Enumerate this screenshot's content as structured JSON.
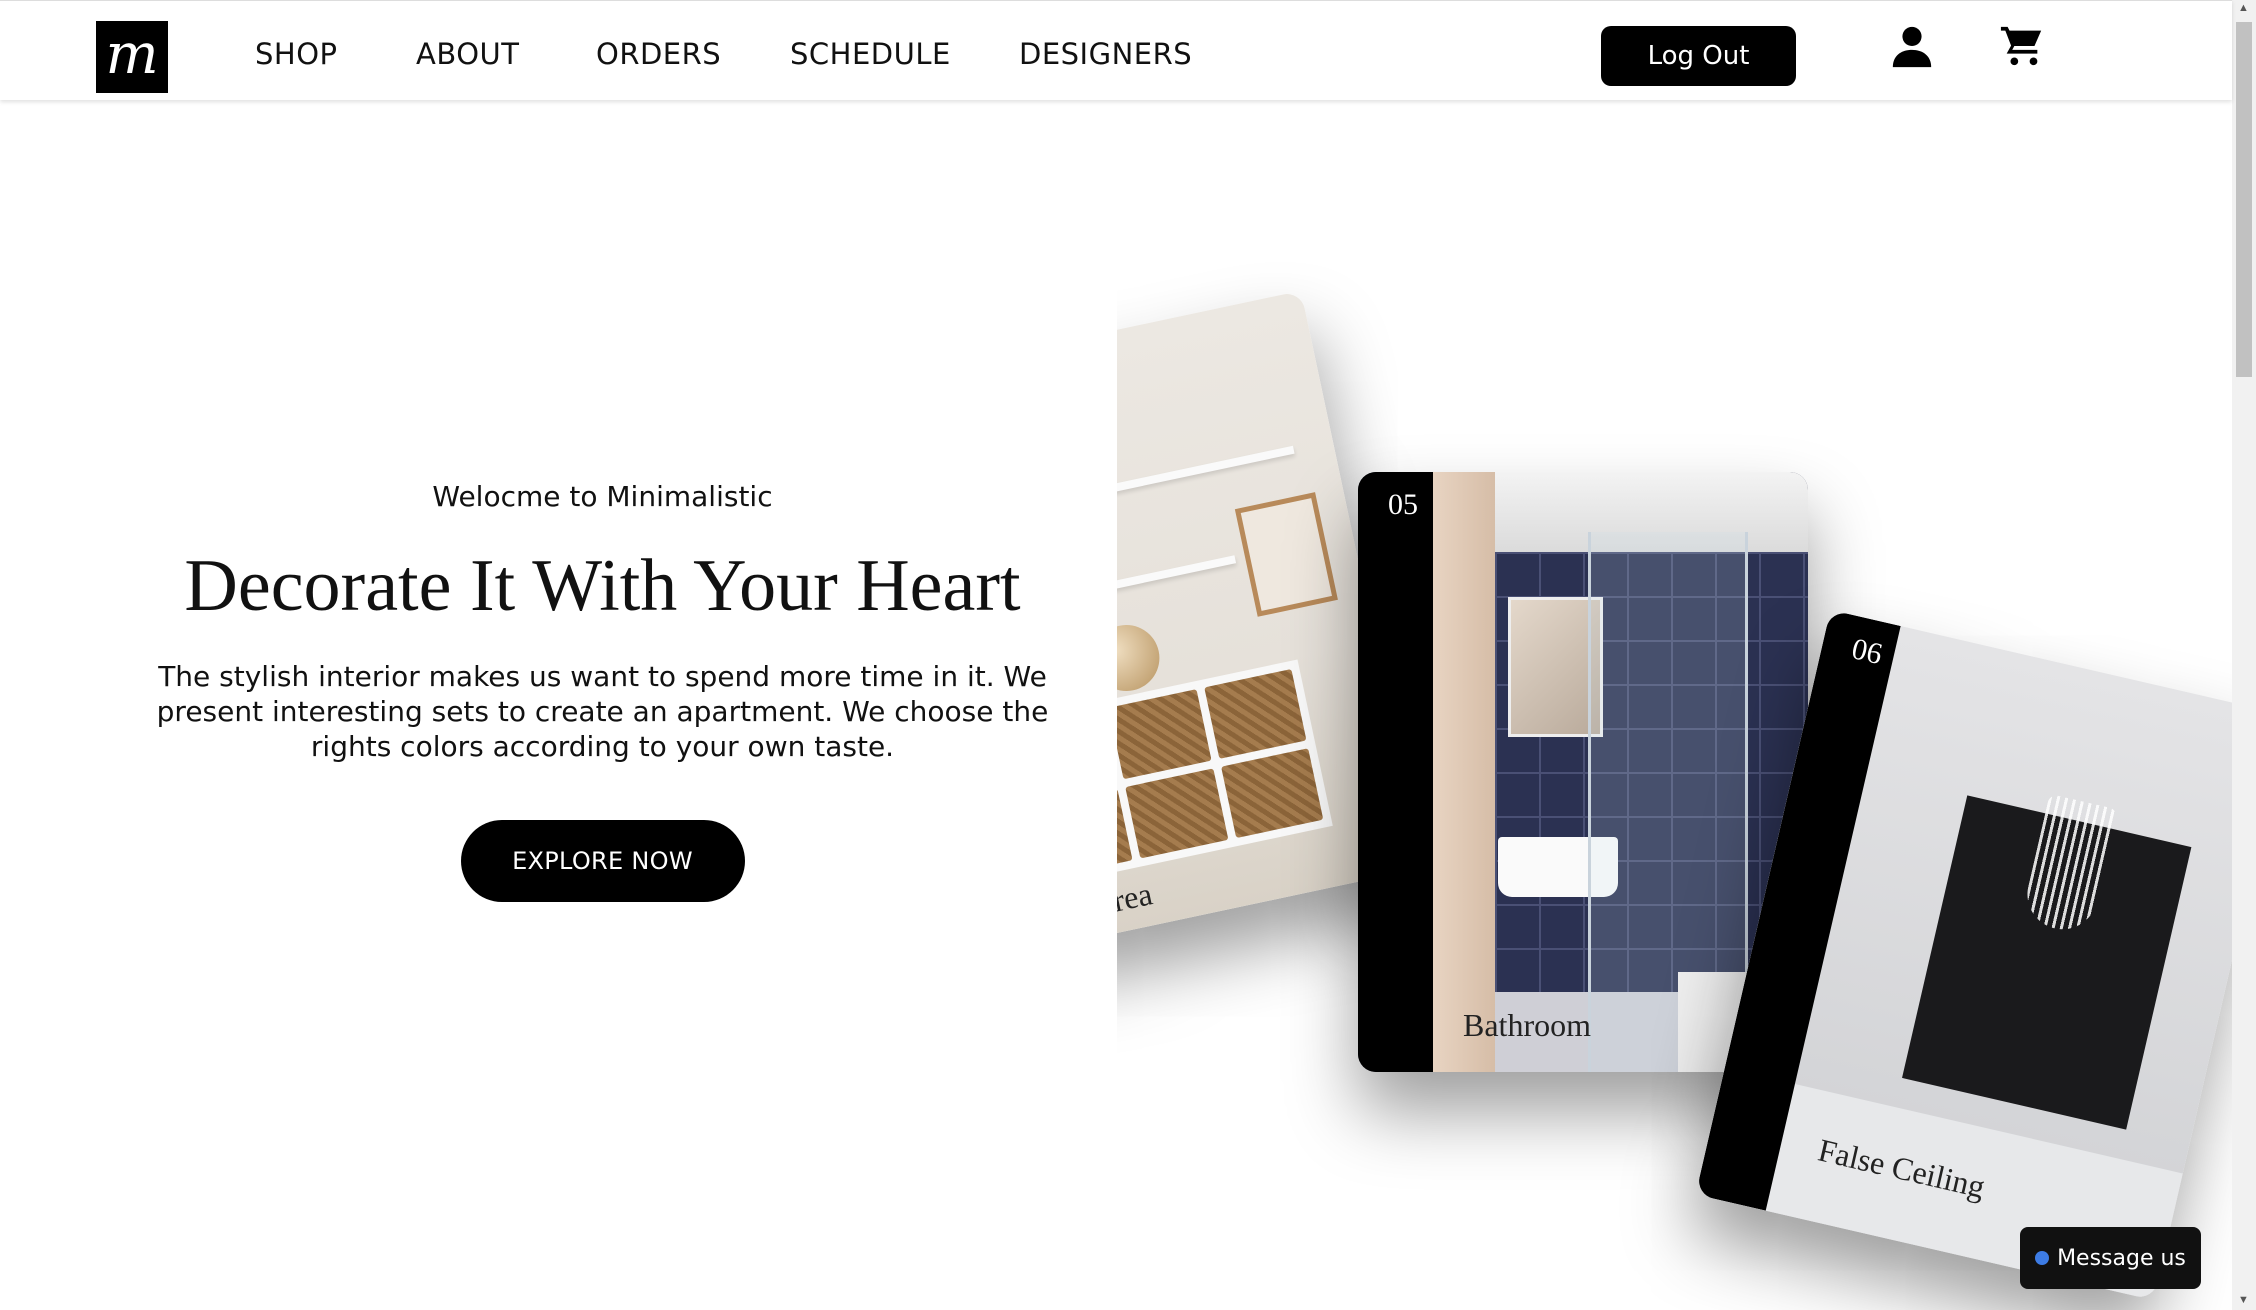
{
  "header": {
    "logo_letter": "m",
    "nav": [
      "SHOP",
      "ABOUT",
      "ORDERS",
      "SCHEDULE",
      "DESIGNERS"
    ],
    "logout_label": "Log Out",
    "icons": [
      "user-icon",
      "cart-icon"
    ]
  },
  "hero": {
    "kicker": "Welocme to Minimalistic",
    "title": "Decorate It With Your Heart",
    "description": "The stylish interior makes us want to spend more time in it. We present interesting sets to create an apartment. We choose the rights colors according to your own taste.",
    "cta_label": "EXPLORE NOW"
  },
  "gallery": {
    "cards": [
      {
        "caption": "Kids Area"
      },
      {
        "number": "05",
        "caption": "Bathroom"
      },
      {
        "number": "06",
        "caption": "False Ceiling"
      }
    ]
  },
  "chat": {
    "label": "Message us"
  },
  "colors": {
    "accent": "#000000",
    "chat_dot": "#3d7ce5"
  }
}
